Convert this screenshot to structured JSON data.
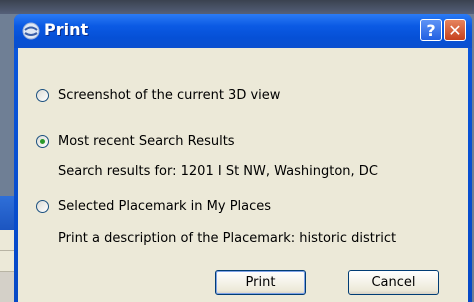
{
  "dialog": {
    "title": "Print",
    "help_label": "?",
    "close_label": "✕"
  },
  "options": [
    {
      "label": "Screenshot of the current 3D view",
      "checked": false
    },
    {
      "label": "Most recent Search Results",
      "checked": true,
      "detail": "Search results for: 1201 I St NW, Washington, DC"
    },
    {
      "label": "Selected Placemark in My Places",
      "checked": false,
      "detail": "Print a description of the Placemark: historic district"
    }
  ],
  "buttons": {
    "print": "Print",
    "cancel": "Cancel"
  },
  "colors": {
    "titlebar": "#0650d6",
    "client_bg": "#ece9d8",
    "close_button": "#c6401d"
  }
}
